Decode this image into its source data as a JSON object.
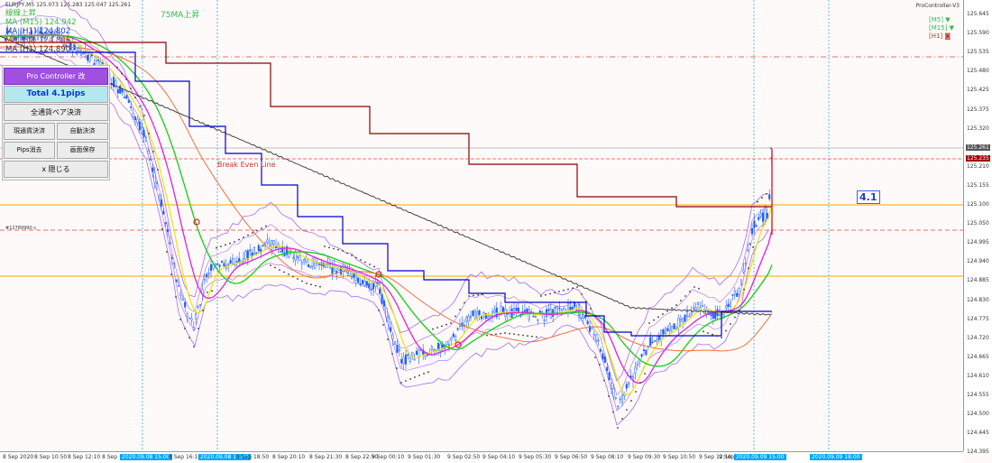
{
  "window": {
    "symbol_info": "EURJPY,M5  125.073 125.283 125.047 125.261",
    "indicator_name": "ProController-V3"
  },
  "indicators": [
    {
      "text": "線線上昇",
      "color": "#2dbf4a"
    },
    {
      "text": "MA (M15) 124.942",
      "color": "#2dbf4a"
    },
    {
      "text": "MA (H1) 124.802",
      "color": "#1b3fd0"
    },
    {
      "text": "MA (H4) 124.806",
      "color": "#c0392b"
    },
    {
      "text": "MA (H1) 124.890",
      "color": "#333333"
    }
  ],
  "ma_title": "75MA上昇",
  "panel": {
    "title": "Pro Controller 改",
    "total": "Total   4.1pips",
    "close_all": "全通貨ペア決済",
    "current_close": "現通貨決済",
    "auto_close": "自動決済",
    "erase_pips": "Pips消去",
    "save_screen": "画面保存",
    "hide": "x 隠じる"
  },
  "tf_legend": [
    {
      "label": "[M5]",
      "color": "#2dbf4a",
      "arrow": "▼",
      "arrow_color": "#2dbf4a"
    },
    {
      "label": "[M15]",
      "color": "#2dbf4a",
      "arrow": "▼",
      "arrow_color": "#2dbf4a"
    },
    {
      "label": "[H1]",
      "color": "#c0392b",
      "arrow": "◙",
      "arrow_color": "#c0392b"
    }
  ],
  "break_even_label": "Break Even Line",
  "level_label": "#12789990 s",
  "pips_value": "4.1",
  "price_axis": {
    "ticks": [
      "125.645",
      "125.590",
      "125.535",
      "125.480",
      "125.425",
      "125.375",
      "125.320",
      "125.265",
      "125.210",
      "125.155",
      "125.100",
      "125.050",
      "124.995",
      "124.940",
      "124.885",
      "124.830",
      "124.775",
      "124.720",
      "124.665",
      "124.610",
      "124.555",
      "124.500",
      "124.445",
      "124.395"
    ],
    "current_price": "125.261",
    "tag_price": "125.235"
  },
  "time_axis": [
    {
      "text": "8 Sep 2020",
      "highlight": false
    },
    {
      "text": "8 Sep 10:50",
      "highlight": false
    },
    {
      "text": "8 Sep 12:10",
      "highlight": false
    },
    {
      "text": "8 Sep 1",
      "highlight": false
    },
    {
      "text": "2020.09.08 15:00",
      "highlight": true
    },
    {
      "text": "8 Sep 16:10",
      "highlight": false
    },
    {
      "text": "2020.09.08 18:00",
      "highlight": true
    },
    {
      "text": "8 Sep 18:50",
      "highlight": false
    },
    {
      "text": "8 Sep 20:10",
      "highlight": false
    },
    {
      "text": "8 Sep 21:30",
      "highlight": false
    },
    {
      "text": "8 Sep 22:50",
      "highlight": false
    },
    {
      "text": "9 Sep 00:10",
      "highlight": false
    },
    {
      "text": "9 Sep 01:30",
      "highlight": false
    },
    {
      "text": "9 Sep 02:50",
      "highlight": false
    },
    {
      "text": "9 Sep 04:10",
      "highlight": false
    },
    {
      "text": "9 Sep 05:30",
      "highlight": false
    },
    {
      "text": "9 Sep 06:50",
      "highlight": false
    },
    {
      "text": "9 Sep 08:10",
      "highlight": false
    },
    {
      "text": "9 Sep 09:30",
      "highlight": false
    },
    {
      "text": "9 Sep 10:50",
      "highlight": false
    },
    {
      "text": "9 Sep 12:10",
      "highlight": false
    },
    {
      "text": "9 Sep 1",
      "highlight": false
    },
    {
      "text": "2020.09.09 15:00",
      "highlight": true
    },
    {
      "text": "2020.09.09 18:00",
      "highlight": true
    }
  ],
  "colors": {
    "background": "#fffafa",
    "candle": "#1c5cff",
    "ma_green": "#1fd11f",
    "ma_magenta": "#e020e0",
    "ma_yellow": "#e8e800",
    "ma_orange": "#f07040",
    "bollinger": "#a56cf0",
    "step_darkred": "#8b0000",
    "step_blue": "#0000d0",
    "long_ma": "#444444",
    "level_orange": "#ffa500"
  }
}
